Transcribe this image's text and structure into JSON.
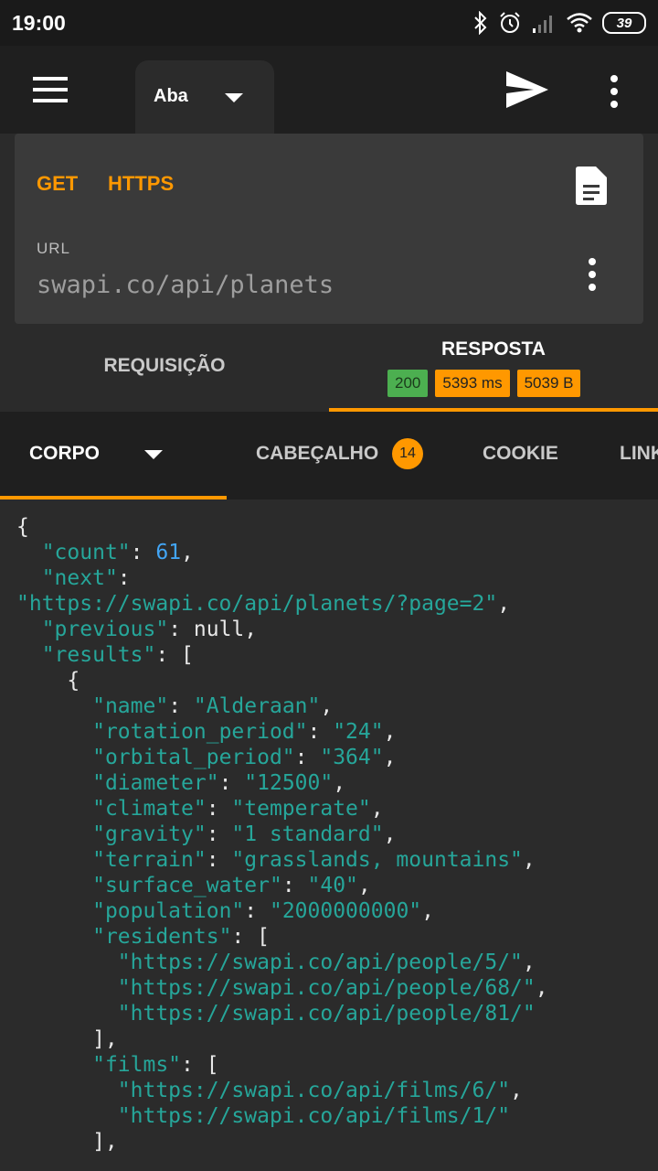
{
  "status_bar": {
    "time": "19:00",
    "battery": "39"
  },
  "app_bar": {
    "tab_name": "Aba"
  },
  "request": {
    "method": "GET",
    "protocol": "HTTPS",
    "url_label": "URL",
    "url": "swapi.co/api/planets"
  },
  "main_tabs": {
    "request": "REQUISIÇÃO",
    "response": "RESPOSTA",
    "status_code": "200",
    "time": "5393 ms",
    "size": "5039 B"
  },
  "sub_tabs": {
    "body": "CORPO",
    "headers": "CABEÇALHO",
    "headers_count": "14",
    "cookie": "COOKIE",
    "link": "LINK"
  },
  "colors": {
    "accent": "#ff9800",
    "success": "#4caf50",
    "json_string": "#26a69a",
    "json_number": "#42a5f5"
  },
  "json_lines": [
    [
      [
        "p",
        "{"
      ]
    ],
    [
      [
        "p",
        "  "
      ],
      [
        "k",
        "\"count\""
      ],
      [
        "p",
        ": "
      ],
      [
        "n",
        "61"
      ],
      [
        "p",
        ","
      ]
    ],
    [
      [
        "p",
        "  "
      ],
      [
        "k",
        "\"next\""
      ],
      [
        "p",
        ":"
      ]
    ],
    [
      [
        "s",
        "\"https://swapi.co/api/planets/?page=2\""
      ],
      [
        "p",
        ","
      ]
    ],
    [
      [
        "p",
        "  "
      ],
      [
        "k",
        "\"previous\""
      ],
      [
        "p",
        ": null,"
      ]
    ],
    [
      [
        "p",
        "  "
      ],
      [
        "k",
        "\"results\""
      ],
      [
        "p",
        ": ["
      ]
    ],
    [
      [
        "p",
        "    {"
      ]
    ],
    [
      [
        "p",
        "      "
      ],
      [
        "k",
        "\"name\""
      ],
      [
        "p",
        ": "
      ],
      [
        "s",
        "\"Alderaan\""
      ],
      [
        "p",
        ","
      ]
    ],
    [
      [
        "p",
        "      "
      ],
      [
        "k",
        "\"rotation_period\""
      ],
      [
        "p",
        ": "
      ],
      [
        "s",
        "\"24\""
      ],
      [
        "p",
        ","
      ]
    ],
    [
      [
        "p",
        "      "
      ],
      [
        "k",
        "\"orbital_period\""
      ],
      [
        "p",
        ": "
      ],
      [
        "s",
        "\"364\""
      ],
      [
        "p",
        ","
      ]
    ],
    [
      [
        "p",
        "      "
      ],
      [
        "k",
        "\"diameter\""
      ],
      [
        "p",
        ": "
      ],
      [
        "s",
        "\"12500\""
      ],
      [
        "p",
        ","
      ]
    ],
    [
      [
        "p",
        "      "
      ],
      [
        "k",
        "\"climate\""
      ],
      [
        "p",
        ": "
      ],
      [
        "s",
        "\"temperate\""
      ],
      [
        "p",
        ","
      ]
    ],
    [
      [
        "p",
        "      "
      ],
      [
        "k",
        "\"gravity\""
      ],
      [
        "p",
        ": "
      ],
      [
        "s",
        "\"1 standard\""
      ],
      [
        "p",
        ","
      ]
    ],
    [
      [
        "p",
        "      "
      ],
      [
        "k",
        "\"terrain\""
      ],
      [
        "p",
        ": "
      ],
      [
        "s",
        "\"grasslands, mountains\""
      ],
      [
        "p",
        ","
      ]
    ],
    [
      [
        "p",
        "      "
      ],
      [
        "k",
        "\"surface_water\""
      ],
      [
        "p",
        ": "
      ],
      [
        "s",
        "\"40\""
      ],
      [
        "p",
        ","
      ]
    ],
    [
      [
        "p",
        "      "
      ],
      [
        "k",
        "\"population\""
      ],
      [
        "p",
        ": "
      ],
      [
        "s",
        "\"2000000000\""
      ],
      [
        "p",
        ","
      ]
    ],
    [
      [
        "p",
        "      "
      ],
      [
        "k",
        "\"residents\""
      ],
      [
        "p",
        ": ["
      ]
    ],
    [
      [
        "p",
        "        "
      ],
      [
        "s",
        "\"https://swapi.co/api/people/5/\""
      ],
      [
        "p",
        ","
      ]
    ],
    [
      [
        "p",
        "        "
      ],
      [
        "s",
        "\"https://swapi.co/api/people/68/\""
      ],
      [
        "p",
        ","
      ]
    ],
    [
      [
        "p",
        "        "
      ],
      [
        "s",
        "\"https://swapi.co/api/people/81/\""
      ]
    ],
    [
      [
        "p",
        "      ],"
      ]
    ],
    [
      [
        "p",
        "      "
      ],
      [
        "k",
        "\"films\""
      ],
      [
        "p",
        ": ["
      ]
    ],
    [
      [
        "p",
        "        "
      ],
      [
        "s",
        "\"https://swapi.co/api/films/6/\""
      ],
      [
        "p",
        ","
      ]
    ],
    [
      [
        "p",
        "        "
      ],
      [
        "s",
        "\"https://swapi.co/api/films/1/\""
      ]
    ],
    [
      [
        "p",
        "      ],"
      ]
    ]
  ]
}
